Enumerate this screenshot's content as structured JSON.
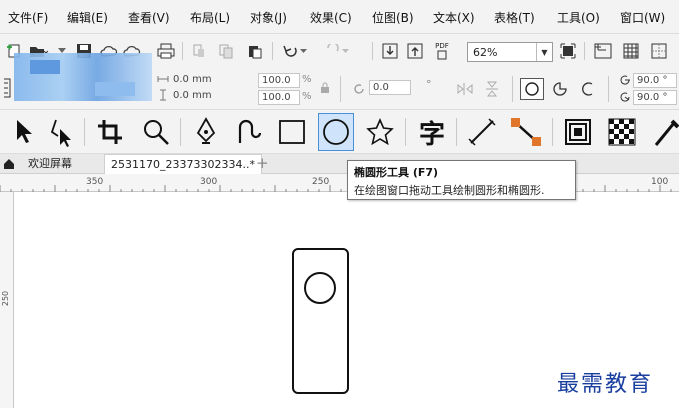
{
  "menu": {
    "items": [
      {
        "label": "文件(F)"
      },
      {
        "label": "编辑(E)"
      },
      {
        "label": "查看(V)"
      },
      {
        "label": "布局(L)"
      },
      {
        "label": "对象(J)"
      },
      {
        "label": "效果(C)"
      },
      {
        "label": "位图(B)"
      },
      {
        "label": "文本(X)"
      },
      {
        "label": "表格(T)"
      },
      {
        "label": "工具(O)"
      },
      {
        "label": "窗口(W)"
      }
    ]
  },
  "toolbar": {
    "zoom_value": "62%",
    "pdf_label": "PDF"
  },
  "property_bar": {
    "x_offset": "0.0 mm",
    "y_offset": "0.0 mm",
    "scale_x": "100.0",
    "scale_y": "100.0",
    "percent": "%",
    "rotation": "0.0",
    "degree_sign": "°",
    "angle_start": "90.0 °",
    "angle_end": "90.0 °"
  },
  "toolbox": {
    "text_tool_glyph": "字"
  },
  "tabs": {
    "welcome": "欢迎屏幕",
    "document": "2531170_23373302334..*",
    "add": "+"
  },
  "ruler": {
    "labels": [
      "350",
      "300",
      "250",
      "100"
    ],
    "vertical_label": "250"
  },
  "tooltip": {
    "title": "椭圆形工具 (F7)",
    "description": "在绘图窗口拖动工具绘制圆形和椭圆形."
  },
  "watermark": "最需教育",
  "colors": {
    "accent": "#4a90d9",
    "active_tool_bg": "#cfe4fb",
    "watermark": "#1a3f9e",
    "chrome": "#f3f3f3"
  },
  "icons": {
    "standard": [
      "new-document-icon",
      "open-icon",
      "save-icon",
      "print-icon",
      "cut-icon",
      "copy-icon",
      "paste-icon",
      "undo-icon",
      "redo-icon",
      "import-icon",
      "export-icon",
      "publish-pdf-icon",
      "full-screen-icon",
      "show-rulers-icon",
      "show-grid-icon",
      "guidelines-icon"
    ],
    "tools": [
      "pick-tool-icon",
      "shape-tool-icon",
      "crop-tool-icon",
      "zoom-tool-icon",
      "pen-tool-icon",
      "artistic-media-icon",
      "rectangle-tool-icon",
      "ellipse-tool-icon",
      "polygon-tool-icon",
      "text-tool-icon",
      "parallel-dimension-icon",
      "connector-icon",
      "contour-tool-icon",
      "transparency-tool-icon",
      "eyedropper-icon"
    ]
  }
}
